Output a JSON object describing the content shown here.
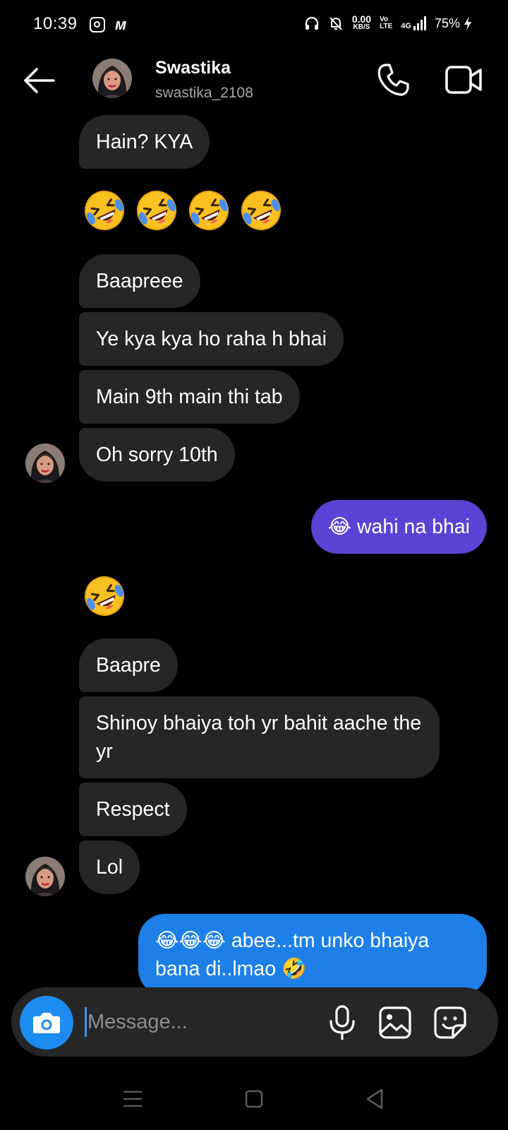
{
  "status_bar": {
    "time": "10:39",
    "net_speed": "0.00",
    "net_unit": "KB/S",
    "volte_top": "Vo",
    "volte_bottom": "LTE",
    "network": "4G",
    "battery": "75%"
  },
  "header": {
    "name": "Swastika",
    "username": "swastika_2108"
  },
  "messages": [
    {
      "from": "them",
      "text": "Hain? KYA"
    },
    {
      "from": "them",
      "text": "🤣🤣🤣🤣"
    },
    {
      "from": "them",
      "text": "Baapreee"
    },
    {
      "from": "them",
      "text": "Ye kya kya ho raha h bhai"
    },
    {
      "from": "them",
      "text": "Main 9th main thi tab"
    },
    {
      "from": "them",
      "text": "Oh sorry 10th"
    },
    {
      "from": "me",
      "text": "😂 wahi na bhai"
    },
    {
      "from": "them",
      "text": "🤣"
    },
    {
      "from": "them",
      "text": "Baapre"
    },
    {
      "from": "them",
      "text": "Shinoy bhaiya toh yr bahit aache the yr"
    },
    {
      "from": "them",
      "text": "Respect"
    },
    {
      "from": "them",
      "text": "Lol"
    },
    {
      "from": "me",
      "text": "😂😂😂 abee...tm unko bhaiya bana di..lmao 🤣"
    }
  ],
  "composer": {
    "placeholder": "Message..."
  },
  "colors": {
    "incoming_bubble": "#262626",
    "outgoing_purple": "#5b43d6",
    "outgoing_blue": "#1d7fe8",
    "camera_button": "#1c8cf0"
  },
  "icons": [
    "back-arrow-icon",
    "phone-icon",
    "video-camera-icon",
    "camera-icon",
    "microphone-icon",
    "gallery-icon",
    "sticker-icon",
    "menu-icon",
    "home-icon",
    "back-icon"
  ]
}
